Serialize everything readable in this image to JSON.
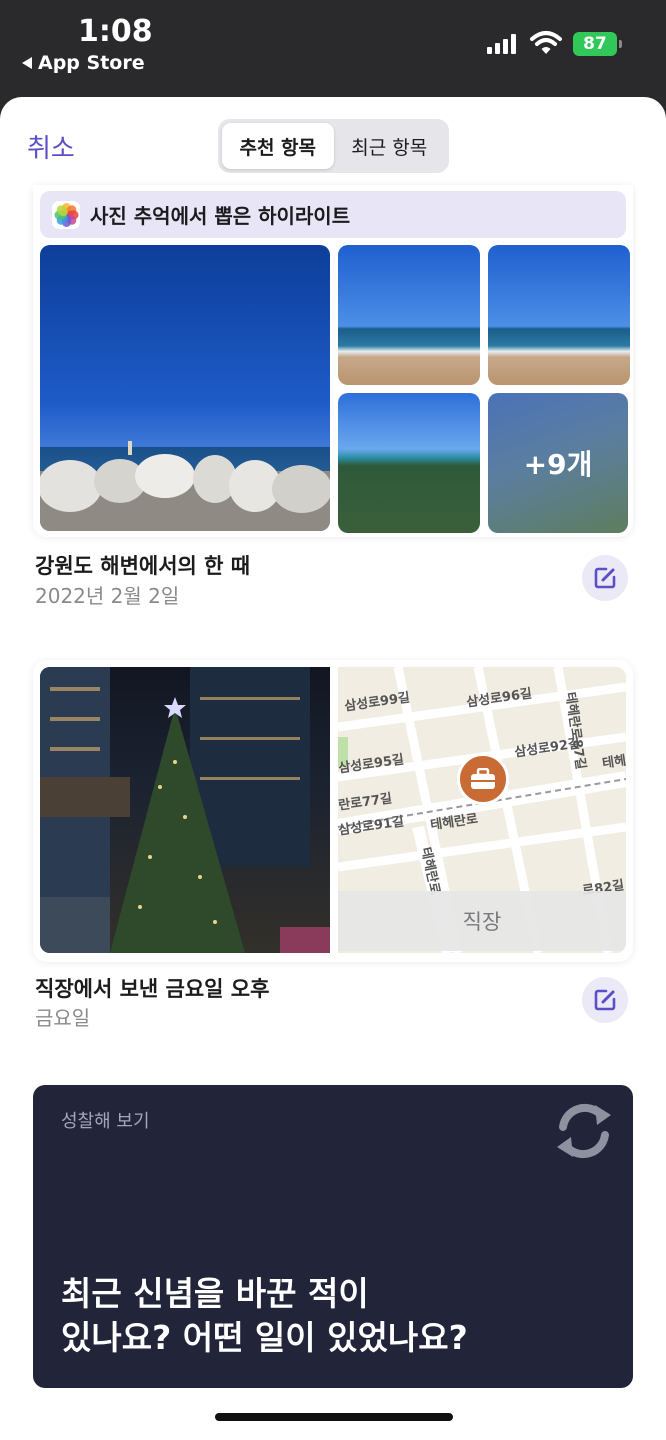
{
  "status_bar": {
    "time": "1:08",
    "back_label": "App Store",
    "battery": "87"
  },
  "header": {
    "cancel": "취소",
    "tabs": [
      {
        "label": "추천 항목",
        "active": true
      },
      {
        "label": "최근 항목",
        "active": false
      }
    ]
  },
  "memory_card": {
    "highlight_label": "사진 추억에서 뽑은 하이라이트",
    "more_count": "+9개",
    "title": "강원도 해변에서의 한 때",
    "date": "2022년 2월 2일"
  },
  "work_card": {
    "map_labels": [
      "삼성로99길",
      "삼성로96길",
      "테헤란로87길",
      "삼성로95길",
      "삼성로92길",
      "테헤",
      "란로77길",
      "삼성로91길",
      "테헤란로",
      "테헤란로",
      "로82길"
    ],
    "place": "직장",
    "title": "직장에서 보낸 금요일 오후",
    "day": "금요일"
  },
  "reflect_card": {
    "label": "성찰해 보기",
    "question_line1": "최근 신념을 바꾼 적이",
    "question_line2": "있나요? 어떤 일이 있었나요?"
  },
  "colors": {
    "accent": "#5b4fc7",
    "reflect_bg": "#22243a",
    "battery": "#31c759",
    "pin": "#c86b35"
  }
}
